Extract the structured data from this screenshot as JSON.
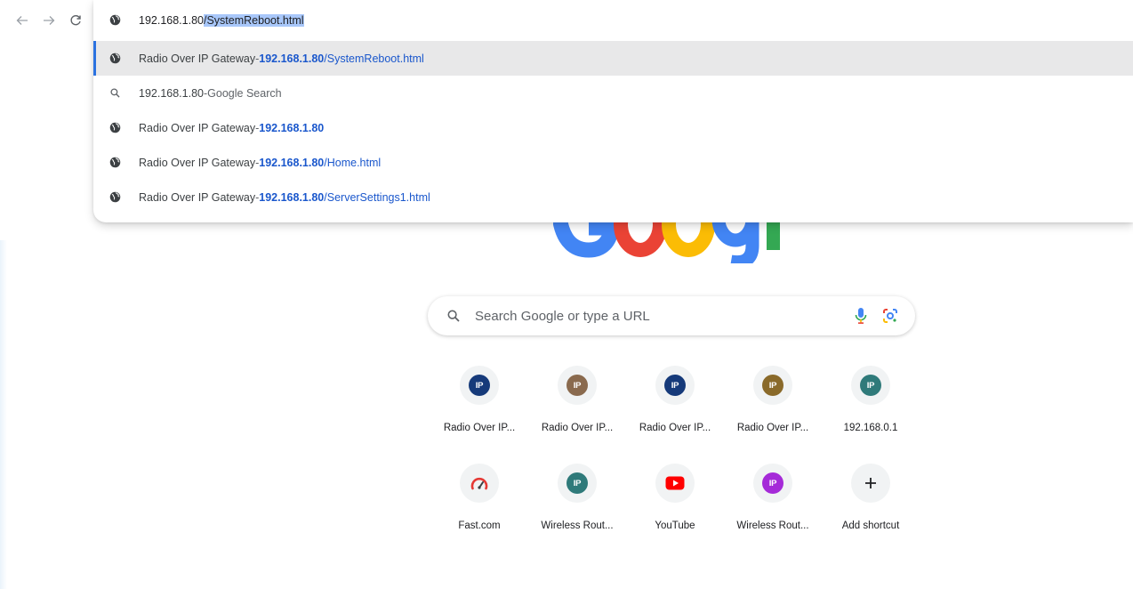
{
  "omnibox": {
    "url_host": "192.168.1.80",
    "url_path_selected": "/SystemReboot.html"
  },
  "suggestions": [
    {
      "icon": "globe-icon",
      "title": "Radio Over IP Gateway",
      "sep": " - ",
      "host": "192.168.1.80",
      "path": "/SystemReboot.html",
      "active": true
    },
    {
      "icon": "search-icon",
      "query": "192.168.1.80",
      "sep": " - ",
      "suffix": "Google Search"
    },
    {
      "icon": "globe-icon",
      "title": "Radio Over IP Gateway",
      "sep": " - ",
      "host": "192.168.1.80",
      "path": ""
    },
    {
      "icon": "globe-icon",
      "title": "Radio Over IP Gateway",
      "sep": " - ",
      "host": "192.168.1.80",
      "path": "/Home.html"
    },
    {
      "icon": "globe-icon",
      "title": "Radio Over IP Gateway",
      "sep": " - ",
      "host": "192.168.1.80",
      "path": "/ServerSettings1.html"
    }
  ],
  "search": {
    "placeholder": "Search Google or type a URL"
  },
  "shortcuts": [
    {
      "label": "Radio Over IP...",
      "badge": "IP",
      "color": "#163a7a"
    },
    {
      "label": "Radio Over IP...",
      "badge": "IP",
      "color": "#8a6a4e"
    },
    {
      "label": "Radio Over IP...",
      "badge": "IP",
      "color": "#163a7a"
    },
    {
      "label": "Radio Over IP...",
      "badge": "IP",
      "color": "#8a6a2a"
    },
    {
      "label": "192.168.0.1",
      "badge": "IP",
      "color": "#2f7a7a"
    },
    {
      "label": "Fast.com",
      "icon": "speedometer-icon",
      "color": "#e53935"
    },
    {
      "label": "Wireless Rout...",
      "badge": "IP",
      "color": "#2f7a7a"
    },
    {
      "label": "YouTube",
      "icon": "youtube-icon",
      "color": "#ff0000"
    },
    {
      "label": "Wireless Rout...",
      "badge": "IP",
      "color": "#a52ad8"
    },
    {
      "label": "Add shortcut",
      "icon": "plus-icon",
      "color": "#202124"
    }
  ],
  "colors": {
    "link": "#1a57cc",
    "selection": "#a8c7fa",
    "active_row": "#e8e8e9",
    "active_bar": "#2b72e0"
  }
}
